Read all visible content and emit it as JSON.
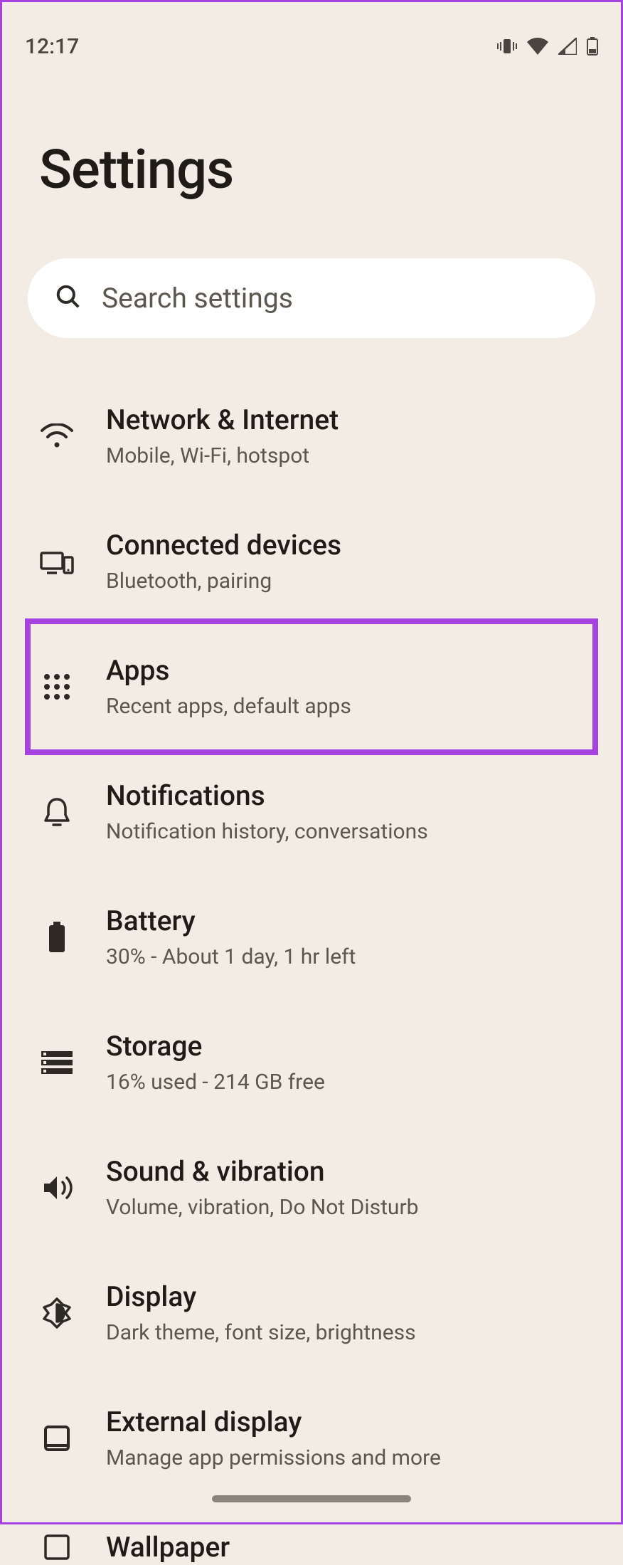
{
  "statusbar": {
    "time": "12:17"
  },
  "page": {
    "title": "Settings"
  },
  "search": {
    "placeholder": "Search settings"
  },
  "items": [
    {
      "icon": "wifi-icon",
      "title": "Network & Internet",
      "subtitle": "Mobile, Wi-Fi, hotspot"
    },
    {
      "icon": "devices-icon",
      "title": "Connected devices",
      "subtitle": "Bluetooth, pairing"
    },
    {
      "icon": "apps-grid-icon",
      "title": "Apps",
      "subtitle": "Recent apps, default apps"
    },
    {
      "icon": "bell-icon",
      "title": "Notifications",
      "subtitle": "Notification history, conversations"
    },
    {
      "icon": "battery-icon",
      "title": "Battery",
      "subtitle": "30% - About 1 day, 1 hr left"
    },
    {
      "icon": "storage-icon",
      "title": "Storage",
      "subtitle": "16% used - 214 GB free"
    },
    {
      "icon": "sound-icon",
      "title": "Sound & vibration",
      "subtitle": "Volume, vibration, Do Not Disturb"
    },
    {
      "icon": "display-icon",
      "title": "Display",
      "subtitle": "Dark theme, font size, brightness"
    },
    {
      "icon": "external-display-icon",
      "title": "External display",
      "subtitle": "Manage app permissions and more"
    },
    {
      "icon": "wallpaper-icon",
      "title": "Wallpaper",
      "subtitle": ""
    }
  ],
  "highlight_index": 2,
  "colors": {
    "bg": "#f3ece4",
    "accent": "#a642e0",
    "text": "#1f1c18",
    "subtext": "#5b564f"
  }
}
